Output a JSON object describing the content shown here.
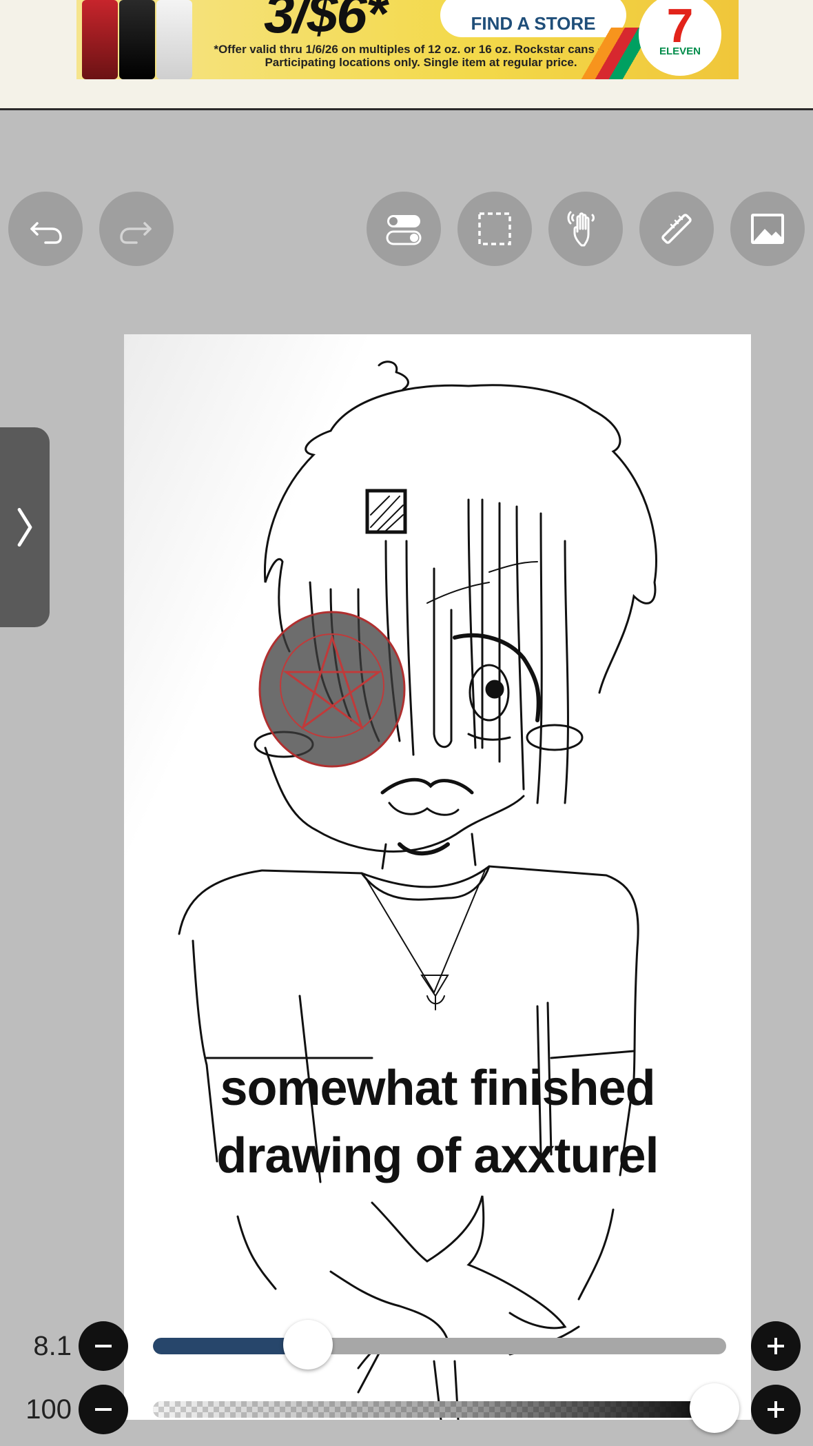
{
  "ad": {
    "price": "3/$6*",
    "cta_label": "FIND A STORE",
    "fine_print": "*Offer valid thru 1/6/26 on multiples of 12 oz. or 16 oz. Rockstar cans + tax. Participating locations only. Single item at regular price.",
    "brand_number": "7",
    "brand_name": "ELEVEN"
  },
  "toolbar": {
    "undo": "undo-icon",
    "redo": "redo-icon",
    "toggle": "toggle-icon",
    "selection": "selection-icon",
    "hand": "hand-icon",
    "ruler": "ruler-icon",
    "image": "image-icon"
  },
  "side_panel": {
    "icon": "chevron-right-icon"
  },
  "canvas": {
    "caption_line1": "somewhat finished",
    "caption_line2": "drawing of axxturel"
  },
  "brush_size": {
    "value": "8.1",
    "fill_fraction": 0.27
  },
  "opacity": {
    "value": "100",
    "fill_fraction": 0.98
  },
  "colors": {
    "workspace": "#bdbdbd",
    "size_fill": "#27466b",
    "button": "#111111",
    "tool_button": "#969696"
  }
}
